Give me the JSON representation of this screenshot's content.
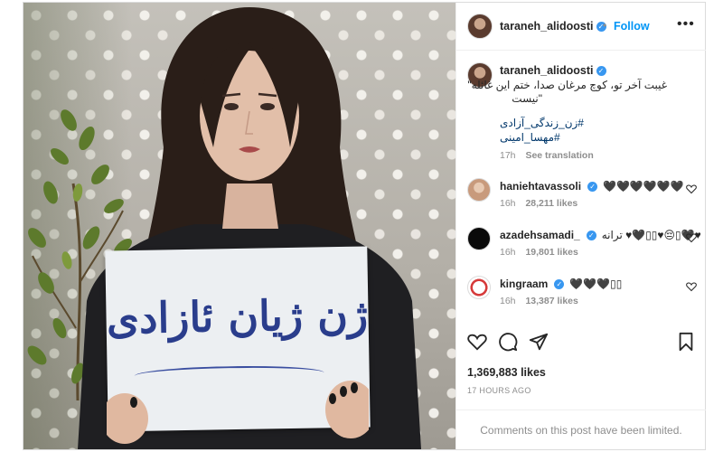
{
  "post": {
    "author": "taraneh_alidoosti",
    "follow_label": "Follow",
    "dot": "•",
    "more": "•••",
    "sign_text": "ژن ژیان ئازادی"
  },
  "caption": {
    "author": "taraneh_alidoosti",
    "line1": "غیبت آخر تو، کوچ مرغان صدا، ختم این غائله\"",
    "line2": "\"نیست",
    "hashtag1": "#زن_زندگی_آزادی",
    "hashtag2": "#مهسا_امینی",
    "time": "17h",
    "see_translation": "See translation"
  },
  "comments": [
    {
      "user": "haniehtavassoli",
      "text": "🖤🖤🖤🖤🖤🖤",
      "time": "16h",
      "likes": "28,211 likes"
    },
    {
      "user": "azadehsamadi_",
      "text": "ترانه ♥︎🖤▯▯♥︎😔▯🖤♥︎",
      "time": "16h",
      "likes": "19,801 likes"
    },
    {
      "user": "kingraam",
      "text": "🖤🖤🖤▯▯",
      "time": "16h",
      "likes": "13,387 likes"
    }
  ],
  "stats": {
    "likes": "1,369,883 likes",
    "posted": "17 HOURS AGO",
    "limited_notice": "Comments on this post have been limited."
  },
  "icons": {
    "verified": "verified-check-icon",
    "like": "heart-icon",
    "comment": "comment-bubble-icon",
    "share": "paper-plane-icon",
    "save": "bookmark-icon"
  },
  "colors": {
    "link": "#0095f6",
    "verified": "#3897f0",
    "muted": "#8e8e8e",
    "hashtag": "#00376b"
  }
}
